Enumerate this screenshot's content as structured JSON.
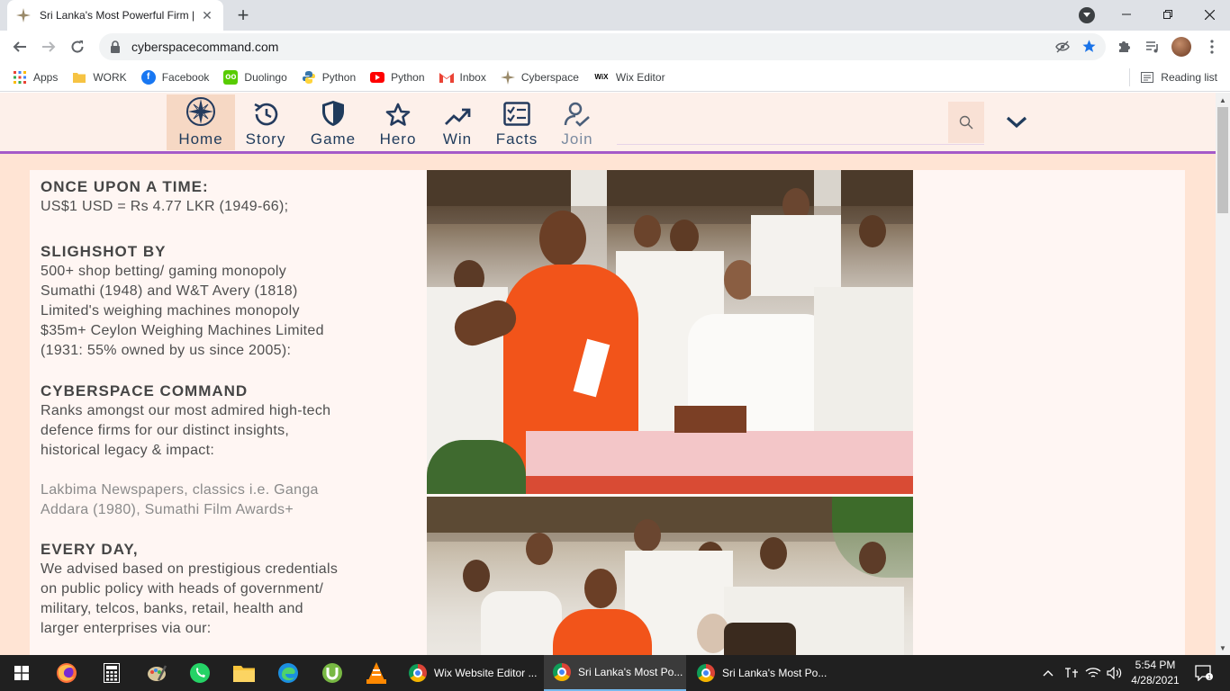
{
  "browser": {
    "tab": {
      "title": "Sri Lanka's Most Powerful Firm | C"
    },
    "address": {
      "url": "cyberspacecommand.com"
    },
    "bookmarks": [
      {
        "label": "Apps",
        "icon": "apps-grid-icon"
      },
      {
        "label": "WORK",
        "icon": "folder-icon"
      },
      {
        "label": "Facebook",
        "icon": "facebook-icon"
      },
      {
        "label": "Duolingo",
        "icon": "duolingo-icon"
      },
      {
        "label": "Python",
        "icon": "python-icon"
      },
      {
        "label": "Python",
        "icon": "youtube-icon"
      },
      {
        "label": "Inbox",
        "icon": "gmail-icon"
      },
      {
        "label": "Cyberspace",
        "icon": "compass-star-icon"
      },
      {
        "label": "Wix Editor",
        "icon": "wix-icon"
      }
    ],
    "reading_list": "Reading list"
  },
  "site": {
    "nav": [
      {
        "label": "Home",
        "icon": "compass-star-icon"
      },
      {
        "label": "Story",
        "icon": "history-icon"
      },
      {
        "label": "Game",
        "icon": "shield-icon"
      },
      {
        "label": "Hero",
        "icon": "star-icon"
      },
      {
        "label": "Win",
        "icon": "trending-up-icon"
      },
      {
        "label": "Facts",
        "icon": "checklist-icon"
      },
      {
        "label": "Join",
        "icon": "user-check-icon"
      }
    ],
    "sections": [
      {
        "heading": "ONCE UPON A TIME:",
        "lines": [
          "US$1 USD = Rs 4.77 LKR (1949-66);"
        ]
      },
      {
        "heading": "SLIGHSHOT BY",
        "lines": [
          "500+ shop betting/ gaming monopoly",
          "Sumathi (1948) and W&T Avery (1818)",
          "Limited's weighing machines monopoly",
          "$35m+ Ceylon Weighing Machines Limited",
          "(1931: 55% owned by us since 2005):"
        ]
      },
      {
        "heading": "CYBERSPACE COMMAND",
        "lines": [
          "Ranks amongst our most admired high-tech",
          "defence firms for our distinct insights,",
          "historical legacy & impact:"
        ]
      },
      {
        "muted_lines": [
          "Lakbima Newspapers, classics i.e. Ganga",
          "Addara (1980), Sumathi Film Awards+"
        ]
      },
      {
        "heading": "EVERY DAY,",
        "lines": [
          "We advised based on prestigious credentials",
          "on public policy with heads of government/",
          "military, telcos, banks, retail, health and",
          "larger enterprises via our:"
        ]
      }
    ],
    "colors": {
      "page_bg": "#ffe4d4",
      "nav_text": "#1f3b5c",
      "accent_line": "#a55ac9"
    }
  },
  "taskbar": {
    "apps": [
      {
        "label": "Wix Website Editor ..."
      },
      {
        "label": "Sri Lanka's Most Po..."
      },
      {
        "label": "Sri Lanka's Most Po..."
      }
    ],
    "time": "5:54 PM",
    "date": "4/28/2021"
  }
}
